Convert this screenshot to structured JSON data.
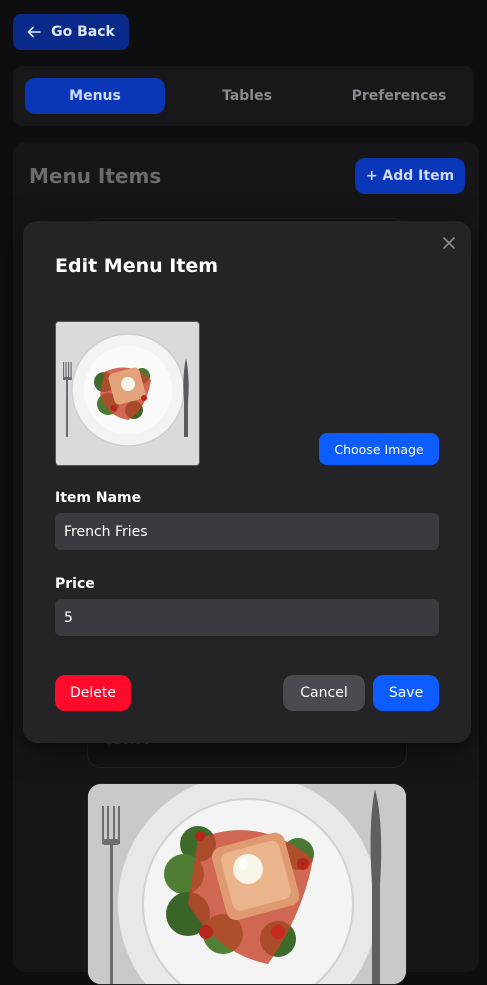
{
  "nav": {
    "back_label": "Go Back"
  },
  "tabs": [
    {
      "label": "Menus",
      "active": true
    },
    {
      "label": "Tables",
      "active": false
    },
    {
      "label": "Preferences",
      "active": false
    }
  ],
  "menu_section": {
    "title": "Menu Items",
    "add_button": "+ Add Item",
    "background_item_price": "$10.00"
  },
  "modal": {
    "title": "Edit Menu Item",
    "choose_image_label": "Choose Image",
    "item_name_label": "Item Name",
    "item_name_value": "French Fries",
    "price_label": "Price",
    "price_value": "5",
    "delete_label": "Delete",
    "cancel_label": "Cancel",
    "save_label": "Save"
  },
  "colors": {
    "accent": "#0d5cff",
    "danger": "#ff0a2a",
    "dim_accent": "#0a36b8"
  }
}
